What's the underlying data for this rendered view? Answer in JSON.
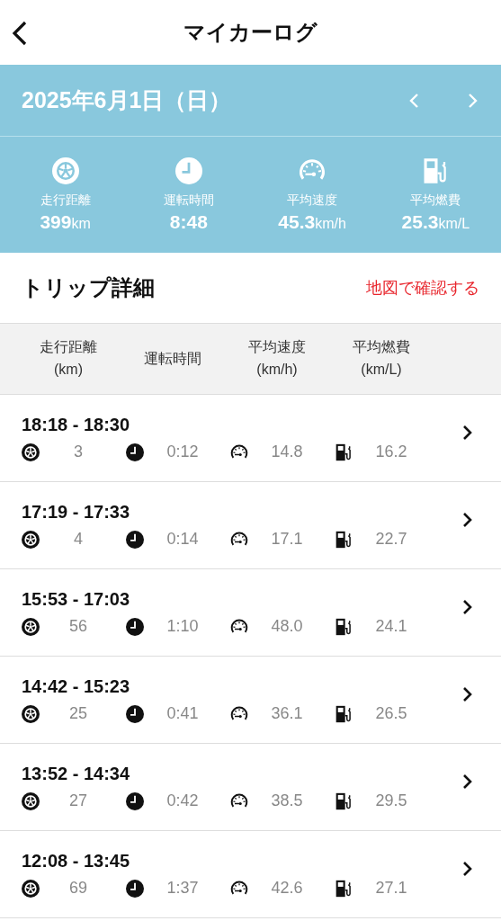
{
  "header": {
    "title": "マイカーログ"
  },
  "date_bar": {
    "date": "2025年6月1日（日）"
  },
  "summary": [
    {
      "kind": "distance",
      "label": "走行距離",
      "value": "399",
      "unit": "km"
    },
    {
      "kind": "time",
      "label": "運転時間",
      "value": "8:48"
    },
    {
      "kind": "speed",
      "label": "平均速度",
      "value": "45.3",
      "unit": "km/h"
    },
    {
      "kind": "fuel",
      "label": "平均燃費",
      "value": "25.3",
      "unit": "km/L"
    }
  ],
  "trips_section": {
    "title": "トリップ詳細",
    "map_link": "地図で確認する"
  },
  "columns": [
    {
      "line1": "走行距離",
      "line2": "(km)"
    },
    {
      "line1": "運転時間"
    },
    {
      "line1": "平均速度",
      "line2": "(km/h)"
    },
    {
      "line1": "平均燃費",
      "line2": "(km/L)"
    }
  ],
  "trips": [
    {
      "time": "18:18 - 18:30",
      "metrics": [
        {
          "kind": "distance",
          "value": "3"
        },
        {
          "kind": "time",
          "value": "0:12"
        },
        {
          "kind": "speed",
          "value": "14.8"
        },
        {
          "kind": "fuel",
          "value": "16.2"
        }
      ]
    },
    {
      "time": "17:19 - 17:33",
      "metrics": [
        {
          "kind": "distance",
          "value": "4"
        },
        {
          "kind": "time",
          "value": "0:14"
        },
        {
          "kind": "speed",
          "value": "17.1"
        },
        {
          "kind": "fuel",
          "value": "22.7"
        }
      ]
    },
    {
      "time": "15:53 - 17:03",
      "metrics": [
        {
          "kind": "distance",
          "value": "56"
        },
        {
          "kind": "time",
          "value": "1:10"
        },
        {
          "kind": "speed",
          "value": "48.0"
        },
        {
          "kind": "fuel",
          "value": "24.1"
        }
      ]
    },
    {
      "time": "14:42 - 15:23",
      "metrics": [
        {
          "kind": "distance",
          "value": "25"
        },
        {
          "kind": "time",
          "value": "0:41"
        },
        {
          "kind": "speed",
          "value": "36.1"
        },
        {
          "kind": "fuel",
          "value": "26.5"
        }
      ]
    },
    {
      "time": "13:52 - 14:34",
      "metrics": [
        {
          "kind": "distance",
          "value": "27"
        },
        {
          "kind": "time",
          "value": "0:42"
        },
        {
          "kind": "speed",
          "value": "38.5"
        },
        {
          "kind": "fuel",
          "value": "29.5"
        }
      ]
    },
    {
      "time": "12:08 - 13:45",
      "metrics": [
        {
          "kind": "distance",
          "value": "69"
        },
        {
          "kind": "time",
          "value": "1:37"
        },
        {
          "kind": "speed",
          "value": "42.6"
        },
        {
          "kind": "fuel",
          "value": "27.1"
        }
      ]
    }
  ]
}
